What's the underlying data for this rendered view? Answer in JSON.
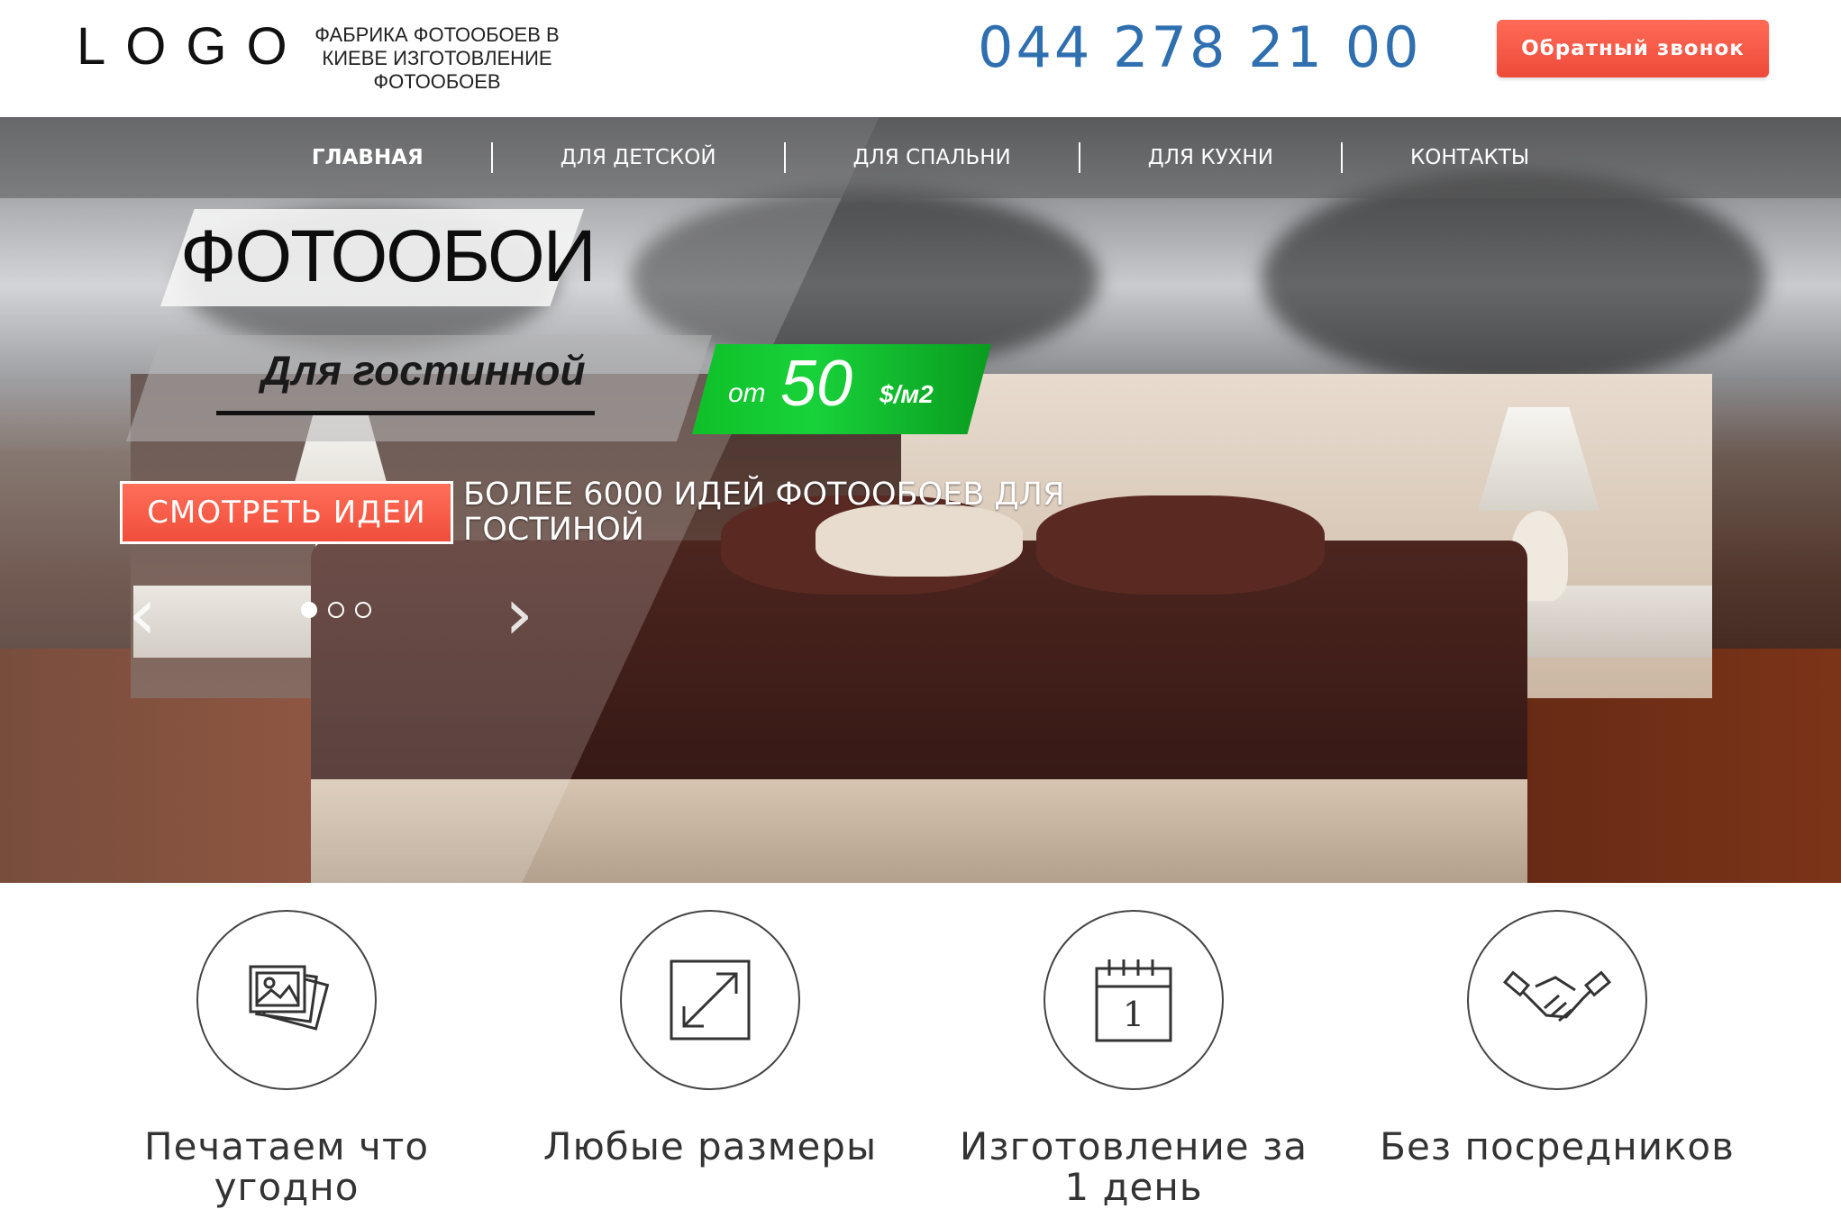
{
  "header": {
    "logo": "LOGO",
    "tagline": "ФАБРИКА ФОТООБОЕВ В КИЕВЕ ИЗГОТОВЛЕНИЕ ФОТООБОЕВ",
    "phone": "044 278 21 00",
    "callback_label": "Обратный звонок"
  },
  "nav": {
    "items": [
      {
        "label": "ГЛАВНАЯ"
      },
      {
        "label": "ДЛЯ ДЕТСКОЙ"
      },
      {
        "label": "ДЛЯ СПАЛЬНИ"
      },
      {
        "label": "ДЛЯ КУХНИ"
      },
      {
        "label": "КОНТАКТЫ"
      }
    ],
    "active_index": 0
  },
  "hero": {
    "title": "ФОТООБОИ",
    "subtitle": "Для гостинной",
    "price": {
      "prefix": "от",
      "value": "50",
      "unit": "$/м2"
    },
    "ideas_button": "СМОТРЕТЬ ИДЕИ",
    "ideas_text": "БОЛЕЕ 6000 ИДЕЙ ФОТООБОЕВ ДЛЯ ГОСТИНОЙ",
    "prev_icon": "chevron-left-icon",
    "next_icon": "chevron-right-icon",
    "slides_total": 3,
    "slide_active": 1
  },
  "features": [
    {
      "icon": "photos-icon",
      "label": "Печатаем что угодно"
    },
    {
      "icon": "resize-icon",
      "label": "Любые размеры"
    },
    {
      "icon": "calendar-icon",
      "label": "Изготовление за 1 день",
      "calendar_day": "1"
    },
    {
      "icon": "handshake-icon",
      "label": "Без посредников"
    }
  ],
  "colors": {
    "phone": "#2f6fb0",
    "callback_button": "#ee4a3a",
    "price_badge": "#18d23a",
    "ideas_button": "#f04d3b"
  }
}
